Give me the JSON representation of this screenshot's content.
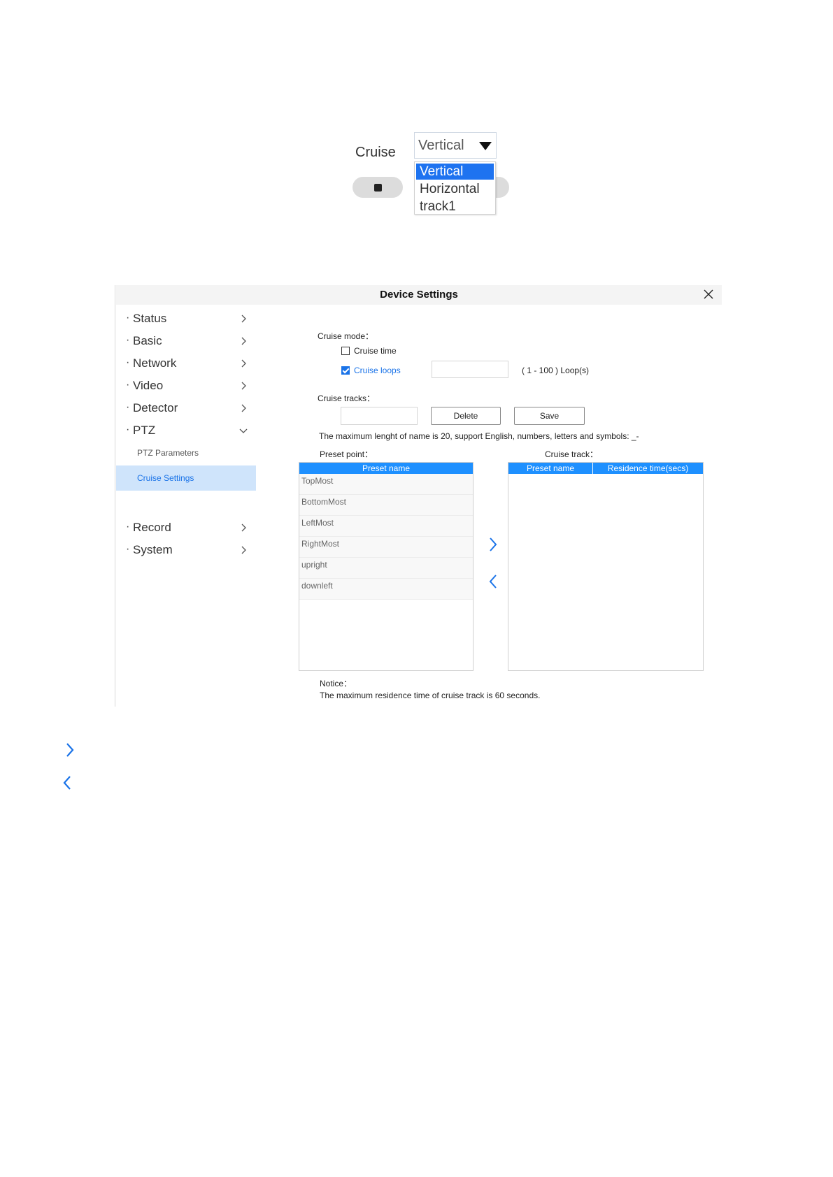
{
  "cruise_widget": {
    "label": "Cruise",
    "mode_selected": "Vertical",
    "mode_options": [
      "Vertical",
      "Horizontal",
      "track1"
    ],
    "highlight_color": "#1e73f0"
  },
  "window": {
    "title": "Device Settings",
    "close_icon": "close-icon"
  },
  "sidebar": {
    "items": [
      {
        "label": "Status"
      },
      {
        "label": "Basic"
      },
      {
        "label": "Network"
      },
      {
        "label": "Video"
      },
      {
        "label": "Detector"
      },
      {
        "label": "PTZ"
      },
      {
        "label": "Record"
      },
      {
        "label": "System"
      }
    ],
    "bullet": "·",
    "sub_items": [
      {
        "label": "PTZ Parameters"
      },
      {
        "label": "Cruise Settings"
      }
    ],
    "active_color": "#1a73e8"
  },
  "content": {
    "cruise_mode_label": "Cruise mode：",
    "cruise_time_label": "Cruise time",
    "cruise_time_checked": false,
    "cruise_loops_label": "Cruise loops",
    "cruise_loops_checked": true,
    "cruise_loops_value": "",
    "loops_range": "( 1 - 100 ) Loop(s)",
    "cruise_tracks_label": "Cruise tracks：",
    "cruise_tracks_value": "",
    "delete_label": "Delete",
    "save_label": "Save",
    "name_hint": "The maximum lenght of name is 20, support English, numbers, letters and symbols: _-",
    "preset_point_label": "Preset point：",
    "cruise_track_label": "Cruise track：",
    "preset_table": {
      "header": "Preset name",
      "rows": [
        "TopMost",
        "BottomMost",
        "LeftMost",
        "RightMost",
        "upright",
        "downleft"
      ]
    },
    "track_table": {
      "headers": [
        "Preset name",
        "Residence time(secs)"
      ],
      "rows": []
    },
    "notice_title": "Notice：",
    "notice_text": "The maximum residence time of cruise track is 60 seconds.",
    "accent_color": "#1e90ff"
  },
  "page_icons": [
    "chevron-right-icon",
    "chevron-left-icon"
  ]
}
